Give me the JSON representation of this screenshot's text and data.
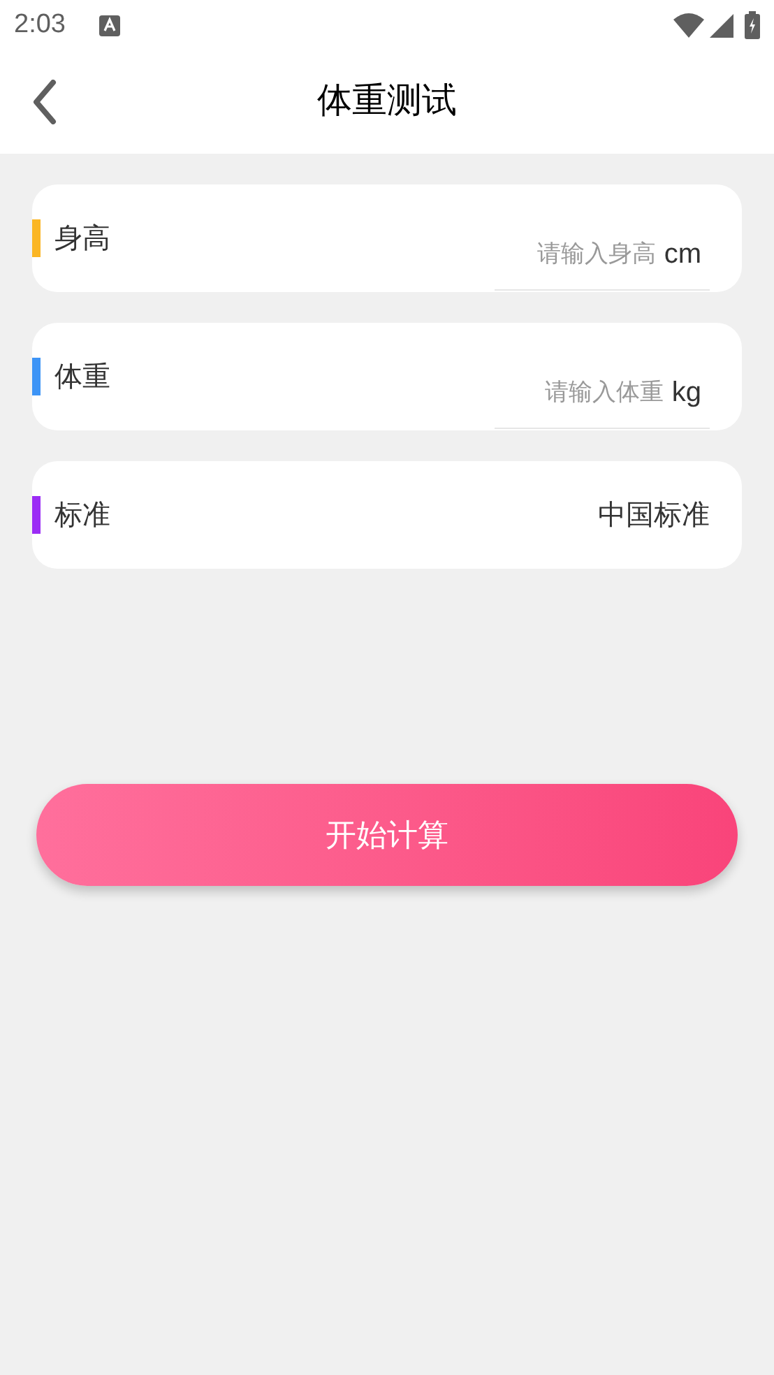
{
  "status_bar": {
    "time": "2:03"
  },
  "header": {
    "title": "体重测试"
  },
  "rows": [
    {
      "kind": "input",
      "label": "身高",
      "color": "#fbb624",
      "placeholder": "请输入身高",
      "unit": "cm"
    },
    {
      "kind": "input",
      "label": "体重",
      "color": "#3d94f6",
      "placeholder": "请输入体重",
      "unit": "kg"
    },
    {
      "kind": "select",
      "label": "标准",
      "color": "#9b2cf5",
      "value": "中国标准"
    }
  ],
  "button": {
    "label": "开始计算"
  }
}
